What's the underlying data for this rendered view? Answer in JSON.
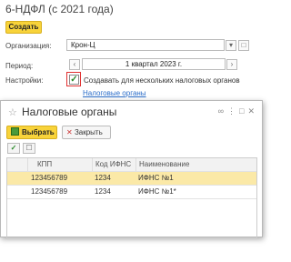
{
  "form": {
    "title": "6-НДФЛ (с 2021 года)",
    "create_button": "Создать",
    "organization_label": "Организация:",
    "organization_value": "Крон-Ц",
    "period_label": "Период:",
    "period_value": "1 квартал 2023 г.",
    "settings_label": "Настройки:",
    "multi_tax_checkbox_label": "Создавать для нескольких налоговых органов",
    "multi_tax_checked": true,
    "tax_authorities_link": "Налоговые органы"
  },
  "modal": {
    "title": "Налоговые органы",
    "select_button": "Выбрать",
    "close_button": "Закрыть",
    "columns": [
      "КПП",
      "Код ИФНС",
      "Наименование"
    ],
    "rows": [
      {
        "checked": true,
        "kpp": "123456789",
        "code": "1234",
        "name": "ИФНС №1",
        "selected": true
      },
      {
        "checked": true,
        "kpp": "123456789",
        "code": "1234",
        "name": "ИФНС №1*",
        "selected": false
      }
    ]
  }
}
